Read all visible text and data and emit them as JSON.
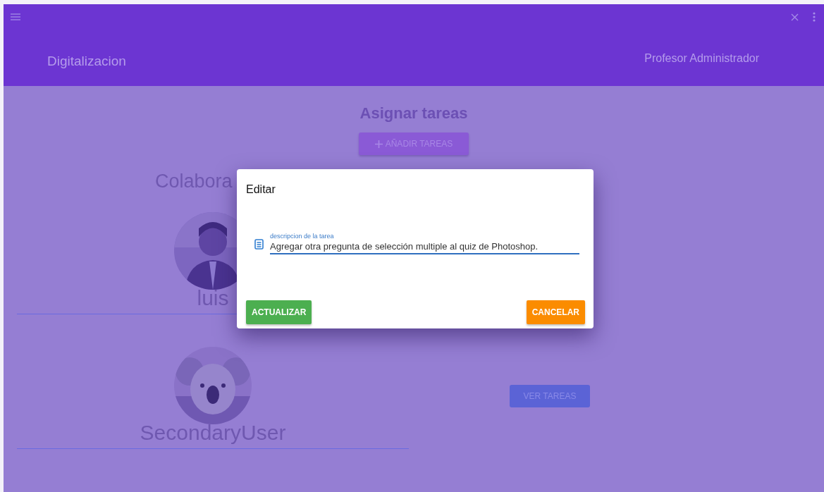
{
  "app_bar": {
    "title": "Digitalizacion",
    "user": "Profesor Administrador"
  },
  "page": {
    "title": "Asignar tareas",
    "add_button": "AÑADIR TAREAS",
    "section_title": "Colabora"
  },
  "collaborators": [
    {
      "name": "luis"
    },
    {
      "name": "SecondaryUser",
      "button": "VER TAREAS"
    }
  ],
  "dialog": {
    "title": "Editar",
    "field": {
      "label": "descripcion de la tarea",
      "value": "Agregar otra pregunta de selección multiple al quiz de Photoshop.",
      "focused": true
    },
    "buttons": [
      {
        "label": "ACTUALIZAR",
        "kind": "confirm"
      },
      {
        "label": "CANCELAR",
        "kind": "cancel"
      }
    ]
  }
}
